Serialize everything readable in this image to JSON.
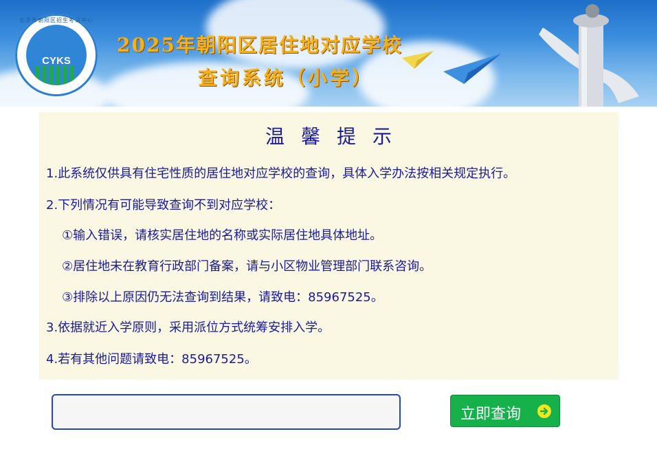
{
  "banner": {
    "title_line1": "2025年朝阳区居住地对应学校",
    "title_line2": "查询系统（小学）",
    "logo_text": "CYKS",
    "logo_ring_text": "北京市朝阳区招生考试中心"
  },
  "notice": {
    "title": "温馨提示",
    "lines": [
      "1.此系统仅供具有住宅性质的居住地对应学校的查询，具体入学办法按相关规定执行。",
      "2.下列情况有可能导致查询不到对应学校：",
      "①输入错误，请核实居住地的名称或实际居住地具体地址。",
      "②居住地未在教育行政部门备案，请与小区物业管理部门联系咨询。",
      "③排除以上原因仍无法查询到结果，请致电：85967525。",
      "3.依据就近入学原则，采用派位方式统筹安排入学。",
      "4.若有其他问题请致电：85967525。"
    ]
  },
  "search": {
    "input_value": "",
    "button_label": "立即查询"
  },
  "colors": {
    "notice_bg": "#faf7e3",
    "notice_text": "#1a1a9c",
    "button_bg": "#17b14c",
    "input_border": "#2146c7",
    "title_gold": "#f5b01a"
  }
}
